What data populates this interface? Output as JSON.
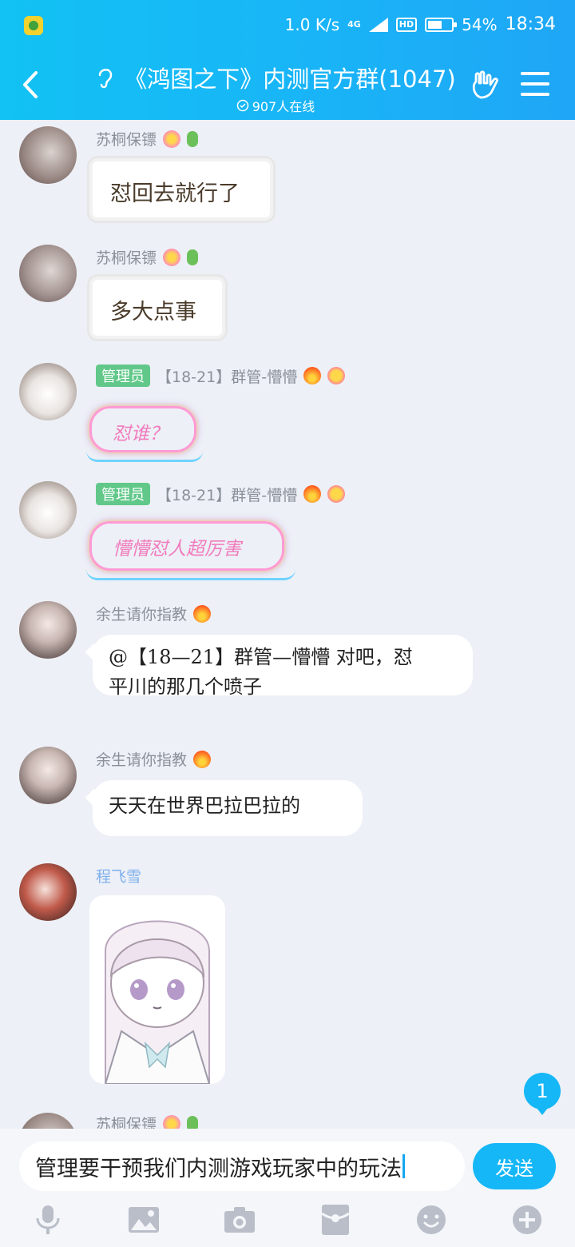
{
  "status_bar": {
    "speed": "1.0 K/s",
    "network": "4G",
    "hd": "HD",
    "battery": "54%",
    "battery_level": 0.54,
    "time": "18:34"
  },
  "header": {
    "title": "《鸿图之下》内测官方群(1047)",
    "online": "907人在线"
  },
  "messages": [
    {
      "sender": "苏桐保镖",
      "text": "怼回去就行了"
    },
    {
      "sender": "苏桐保镖",
      "text": "多大点事"
    },
    {
      "badge": "管理员",
      "sender": "【18-21】群管-懵懵",
      "text": "怼谁？"
    },
    {
      "badge": "管理员",
      "sender": "【18-21】群管-懵懵",
      "text": "懵懵怼人超厉害"
    },
    {
      "sender": "余生请你指教",
      "line1": "@【18—21】群管—懵懵 对吧，怼",
      "line2": "平川的那几个喷子"
    },
    {
      "sender": "余生请你指教",
      "text": "天天在世界巴拉巴拉的"
    },
    {
      "sender": "程飞雪"
    },
    {
      "sender": "苏桐保镖"
    }
  ],
  "unread_count": "1",
  "input": {
    "value": "管理要干预我们内测游戏玩家中的玩法",
    "send_label": "发送"
  },
  "toolbar_icons": [
    "microphone-icon",
    "image-icon",
    "camera-icon",
    "red-packet-icon",
    "emoji-icon",
    "plus-icon"
  ],
  "colors": {
    "header_gradient_start": "#12c2f4",
    "header_gradient_end": "#1fa6f6",
    "accent": "#16b7f7",
    "admin_badge": "#61c88a",
    "background": "#edf0f6"
  }
}
